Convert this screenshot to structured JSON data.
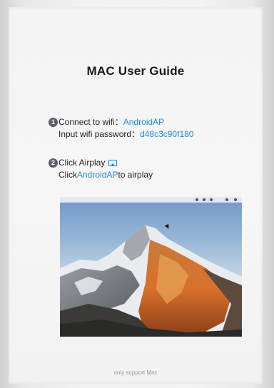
{
  "guide": {
    "title": "MAC User Guide",
    "step1": {
      "number": "1",
      "line1_label": "Connect to wifi：",
      "wifi_name": "AndroidAP",
      "line2_label": "Input wifi password：",
      "wifi_password": "d48c3c90f180"
    },
    "step2": {
      "number": "2",
      "line1_label": "Click Airplay",
      "line2_prefix": "Click",
      "line2_target": "AndroidAP",
      "line2_suffix": "to airplay"
    },
    "footer": "only support Mac"
  },
  "icons": {
    "airplay": "airplay-icon",
    "cursor": "mouse-cursor-icon"
  },
  "colors": {
    "accent_blue": "#1e88d8",
    "badge_gray": "#5a5f6a"
  }
}
